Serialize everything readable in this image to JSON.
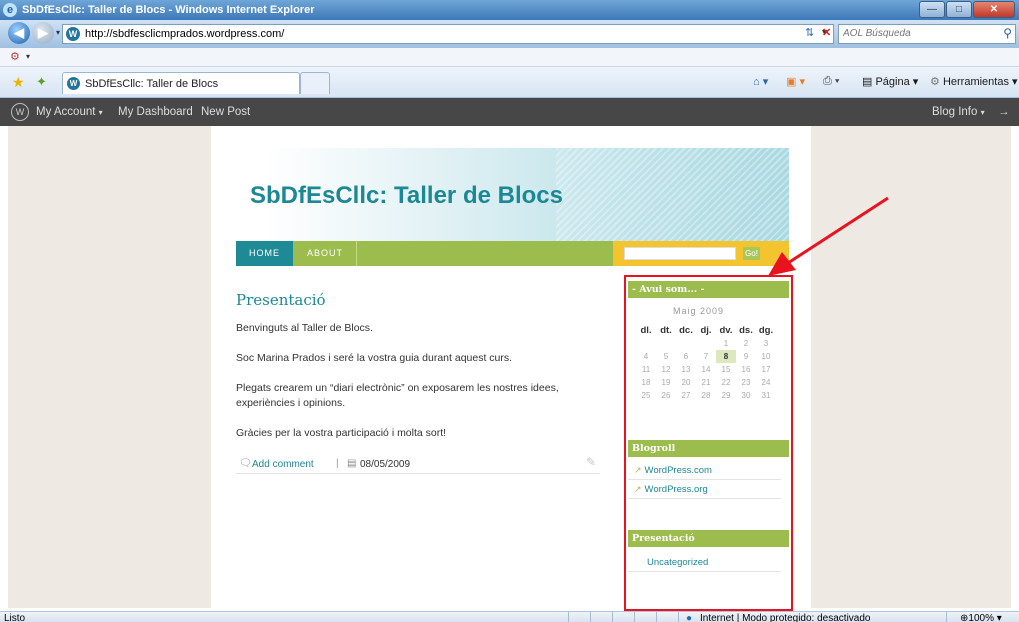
{
  "window": {
    "title": "SbDfEsCllc: Taller de Blocs - Windows Internet Explorer"
  },
  "address": {
    "url": "http://sbdfesclicmprados.wordpress.com/",
    "search_placeholder": "AOL Búsqueda"
  },
  "tabs": [
    {
      "label": "SbDfEsCllc: Taller de Blocs"
    }
  ],
  "toolbar": {
    "page_label": "Página",
    "tools_label": "Herramientas"
  },
  "wpbar": {
    "my_account": "My Account",
    "my_dashboard": "My Dashboard",
    "new_post": "New Post",
    "blog_info": "Blog Info"
  },
  "blog": {
    "title": "SbDfEsCllc: Taller de Blocs",
    "nav": {
      "home": "HOME",
      "about": "ABOUT"
    },
    "search_button": "Go!"
  },
  "post": {
    "title": "Presentació",
    "paragraphs": [
      "Benvinguts al Taller de Blocs.",
      "Soc Marina Prados i seré la vostra guia durant aquest curs.",
      "Plegats crearem un “diari electrònic” on exposarem les nostres idees,",
      "experiències i opinions.",
      "Gràcies per la vostra participació i molta sort!"
    ],
    "add_comment": "Add comment",
    "date": "08/05/2009"
  },
  "sidebar": {
    "calendar": {
      "title": "- Avui som... -",
      "caption": "Maig 2009",
      "days": [
        "dl.",
        "dt.",
        "dc.",
        "dj.",
        "dv.",
        "ds.",
        "dg."
      ],
      "week1": [
        "",
        "",
        "",
        "",
        "1",
        "2",
        "3"
      ],
      "week2": [
        "4",
        "5",
        "6",
        "7",
        "8",
        "9",
        "10"
      ],
      "week3": [
        "11",
        "12",
        "13",
        "14",
        "15",
        "16",
        "17"
      ],
      "week4": [
        "18",
        "19",
        "20",
        "21",
        "22",
        "23",
        "24"
      ],
      "week5": [
        "25",
        "26",
        "27",
        "28",
        "29",
        "30",
        "31"
      ],
      "today": "8"
    },
    "blogroll": {
      "title": "Blogroll",
      "links": [
        "WordPress.com",
        "WordPress.org"
      ]
    },
    "categories": {
      "title": "Presentació",
      "items": [
        "Uncategorized"
      ]
    }
  },
  "status": {
    "left": "Listo",
    "zone": "Internet | Modo protegido: desactivado",
    "zoom": "100%"
  },
  "colors": {
    "accent_teal": "#1d8895",
    "accent_green": "#9cbc4e",
    "annotation_red": "#e8131e"
  }
}
